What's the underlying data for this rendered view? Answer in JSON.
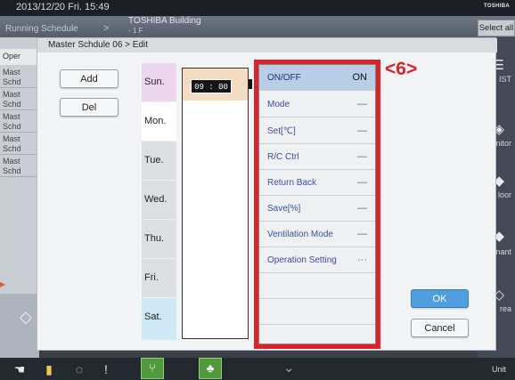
{
  "status": {
    "datetime": "2013/12/20  Fri.  15:49",
    "brand": "TOSHIBA"
  },
  "background": {
    "running_schedule": "Running Schedule",
    "arrow": ">",
    "building": "TOSHIBA Building",
    "floor": "- 1 F",
    "select_all": "Select all",
    "left_header": "Oper",
    "left_rows": [
      "Mast Schd",
      "Mast Schd",
      "Mast Schd",
      "Mast Schd",
      "Mast Schd"
    ],
    "right_items": [
      "IST",
      "nitor",
      "loor",
      "nant",
      "rea"
    ],
    "dock_unit": "Unit"
  },
  "dialog": {
    "title": "Master Schdule 06 > Edit",
    "add_label": "Add",
    "del_label": "Del",
    "ok_label": "OK",
    "cancel_label": "Cancel",
    "selected_day": "Sun.",
    "days": [
      "Sun.",
      "Mon.",
      "Tue.",
      "Wed.",
      "Thu.",
      "Fri.",
      "Sat."
    ],
    "time": "09 : 00",
    "settings": [
      {
        "label": "ON/OFF",
        "value": "ON"
      },
      {
        "label": "Mode",
        "value": "—"
      },
      {
        "label": "Set[℃]",
        "value": "—"
      },
      {
        "label": "R/C Ctrl",
        "value": "—"
      },
      {
        "label": "Return Back",
        "value": "—"
      },
      {
        "label": "Save[%]",
        "value": "—"
      },
      {
        "label": "Ventilation Mode",
        "value": "—"
      },
      {
        "label": "Operation Setting",
        "value": "···"
      }
    ]
  },
  "annotation": "<6>",
  "colors": {
    "highlight_red": "#e02027",
    "selected_row": "#b8cde6",
    "time_slot": "#f4dcc0"
  }
}
